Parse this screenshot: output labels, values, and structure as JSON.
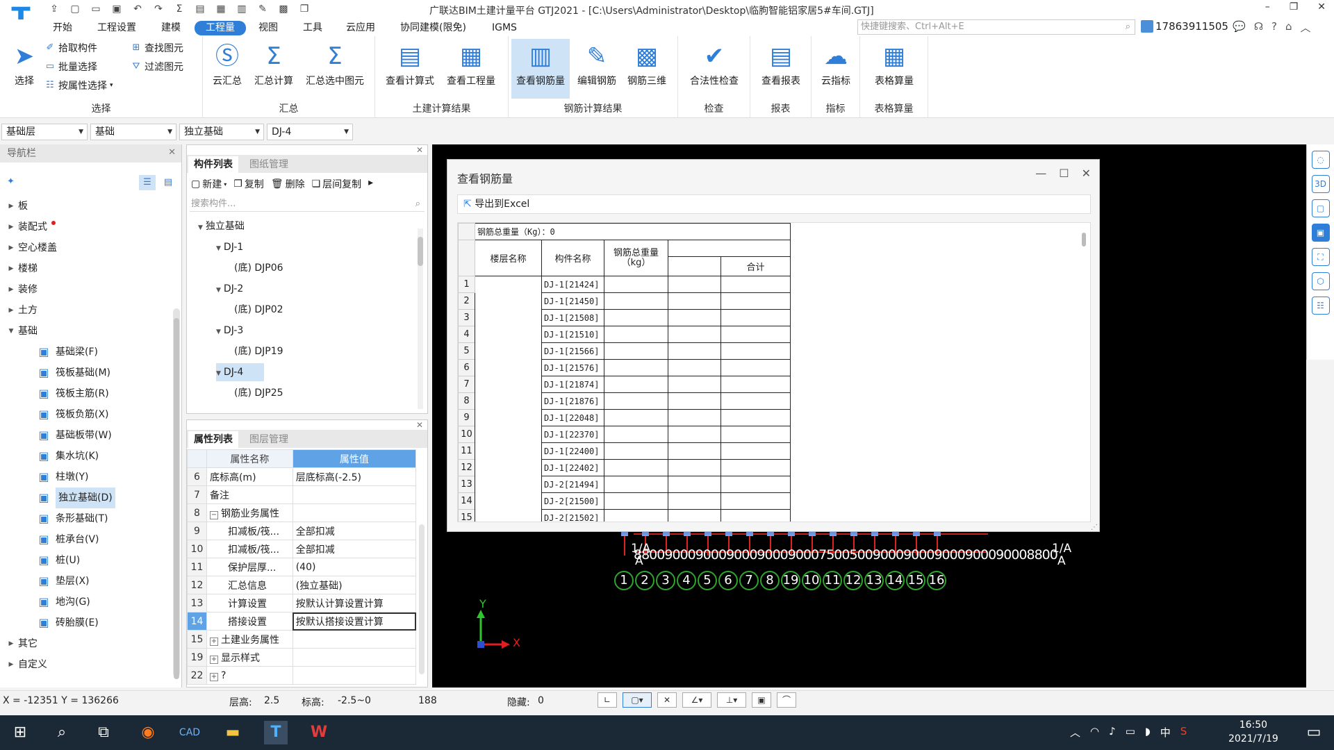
{
  "window": {
    "title": "广联达BIM土建计量平台 GTJ2021 - [C:\\Users\\Administrator\\Desktop\\临朐智能铝家居5#车间.GTJ]",
    "logo": "T"
  },
  "menu": {
    "items": [
      "开始",
      "工程设置",
      "建模",
      "工程量",
      "视图",
      "工具",
      "云应用",
      "协同建模(限免)",
      "IGMS"
    ],
    "active": "工程量",
    "search_placeholder": "快捷键搜索、Ctrl+Alt+E",
    "user_phone": "17863911505"
  },
  "ribbon": {
    "select_group": {
      "label": "选择",
      "select": "选择",
      "pick_component": "拾取构件",
      "batch_select": "批量选择",
      "by_attr_select": "按属性选择",
      "find_element": "查找图元",
      "filter_element": "过滤图元"
    },
    "summary_group": {
      "label": "汇总",
      "cloud_summary": "云汇总",
      "summary_calc": "汇总计算",
      "summary_selected": "汇总选中图元"
    },
    "civil_group": {
      "label": "土建计算结果",
      "view_formula": "查看计算式",
      "view_quantity": "查看工程量"
    },
    "rebar_group": {
      "label": "钢筋计算结果",
      "view_rebar": "查看钢筋量",
      "edit_rebar": "编辑钢筋",
      "rebar_3d": "钢筋三维"
    },
    "check_group": {
      "label": "检查",
      "legality_check": "合法性检查"
    },
    "report_group": {
      "label": "报表",
      "view_report": "查看报表"
    },
    "index_group": {
      "label": "指标",
      "cloud_index": "云指标"
    },
    "table_group": {
      "label": "表格算量",
      "table_calc": "表格算量"
    }
  },
  "filters": {
    "floor": "基础层",
    "category": "基础",
    "type": "独立基础",
    "component": "DJ-4"
  },
  "nav": {
    "title": "导航栏",
    "items": [
      {
        "label": "板",
        "open": false
      },
      {
        "label": "装配式",
        "open": false
      },
      {
        "label": "空心楼盖",
        "open": false
      },
      {
        "label": "楼梯",
        "open": false
      },
      {
        "label": "装修",
        "open": false
      },
      {
        "label": "土方",
        "open": false
      },
      {
        "label": "基础",
        "open": true
      }
    ],
    "children": [
      {
        "label": "基础梁(F)",
        "icon": "beam-icon"
      },
      {
        "label": "筏板基础(M)",
        "icon": "raft-icon"
      },
      {
        "label": "筏板主筋(R)",
        "icon": "raft-main-rebar-icon"
      },
      {
        "label": "筏板负筋(X)",
        "icon": "raft-neg-rebar-icon"
      },
      {
        "label": "基础板带(W)",
        "icon": "slab-strip-icon"
      },
      {
        "label": "集水坑(K)",
        "icon": "sump-icon"
      },
      {
        "label": "柱墩(Y)",
        "icon": "pier-icon"
      },
      {
        "label": "独立基础(D)",
        "icon": "isolated-footing-icon"
      },
      {
        "label": "条形基础(T)",
        "icon": "strip-footing-icon"
      },
      {
        "label": "桩承台(V)",
        "icon": "pile-cap-icon"
      },
      {
        "label": "桩(U)",
        "icon": "pile-icon"
      },
      {
        "label": "垫层(X)",
        "icon": "cushion-icon"
      },
      {
        "label": "地沟(G)",
        "icon": "trench-icon"
      },
      {
        "label": "砖胎膜(E)",
        "icon": "brick-mould-icon"
      }
    ],
    "tail": [
      {
        "label": "其它"
      },
      {
        "label": "自定义"
      }
    ]
  },
  "component_panel": {
    "tabs": [
      "构件列表",
      "图纸管理"
    ],
    "toolbar": {
      "new": "新建",
      "copy": "复制",
      "delete": "删除",
      "floor_copy": "层间复制"
    },
    "search_placeholder": "搜索构件...",
    "tree": [
      {
        "label": "独立基础",
        "level": 0
      },
      {
        "label": "DJ-1",
        "level": 1
      },
      {
        "label": "(底) DJP06",
        "level": 2
      },
      {
        "label": "DJ-2",
        "level": 1
      },
      {
        "label": "(底) DJP02",
        "level": 2
      },
      {
        "label": "DJ-3",
        "level": 1
      },
      {
        "label": "(底) DJP19",
        "level": 2
      },
      {
        "label": "DJ-4",
        "level": 1,
        "selected": true
      },
      {
        "label": "(底) DJP25",
        "level": 2
      }
    ]
  },
  "property_panel": {
    "tabs": [
      "属性列表",
      "图层管理"
    ],
    "headers": {
      "name": "属性名称",
      "value": "属性值"
    },
    "rows": [
      {
        "no": "6",
        "name": "底标高(m)",
        "value": "层底标高(-2.5)"
      },
      {
        "no": "7",
        "name": "备注",
        "value": ""
      },
      {
        "no": "8",
        "name": "钢筋业务属性",
        "value": "",
        "expand": "−"
      },
      {
        "no": "9",
        "name": "扣减板/筏...",
        "value": "全部扣减"
      },
      {
        "no": "10",
        "name": "扣减板/筏...",
        "value": "全部扣减"
      },
      {
        "no": "11",
        "name": "保护层厚...",
        "value": "(40)"
      },
      {
        "no": "12",
        "name": "汇总信息",
        "value": "(独立基础)"
      },
      {
        "no": "13",
        "name": "计算设置",
        "value": "按默认计算设置计算"
      },
      {
        "no": "14",
        "name": "搭接设置",
        "value": "按默认搭接设置计算",
        "selected": true
      },
      {
        "no": "15",
        "name": "土建业务属性",
        "value": "",
        "expand": "+"
      },
      {
        "no": "19",
        "name": "显示样式",
        "value": "",
        "expand": "+"
      },
      {
        "no": "22",
        "name": "?",
        "value": "",
        "expand": "+"
      }
    ]
  },
  "dialog": {
    "title": "查看钢筋量",
    "export_label": "导出到Excel",
    "total_label": "钢筋总重量（Kg）：0",
    "col_floor": "楼层名称",
    "col_component": "构件名称",
    "col_weight": "钢筋总重量\n（kg）",
    "col_total": "合计",
    "rows": [
      {
        "no": "1",
        "name": "DJ-1[21424]"
      },
      {
        "no": "2",
        "name": "DJ-1[21450]"
      },
      {
        "no": "3",
        "name": "DJ-1[21508]"
      },
      {
        "no": "4",
        "name": "DJ-1[21510]"
      },
      {
        "no": "5",
        "name": "DJ-1[21566]"
      },
      {
        "no": "6",
        "name": "DJ-1[21576]"
      },
      {
        "no": "7",
        "name": "DJ-1[21874]"
      },
      {
        "no": "8",
        "name": "DJ-1[21876]"
      },
      {
        "no": "9",
        "name": "DJ-1[22048]"
      },
      {
        "no": "10",
        "name": "DJ-1[22370]"
      },
      {
        "no": "11",
        "name": "DJ-1[22400]"
      },
      {
        "no": "12",
        "name": "DJ-1[22402]"
      },
      {
        "no": "13",
        "name": "DJ-2[21494]"
      },
      {
        "no": "14",
        "name": "DJ-2[21500]"
      },
      {
        "no": "15",
        "name": "DJ-2[21502]"
      }
    ]
  },
  "canvas": {
    "dim_text": "8800900090009000900090007500500900090009000900090008800",
    "grid_labels": [
      "1",
      "2",
      "3",
      "4",
      "5",
      "6",
      "7",
      "8",
      "19",
      "10",
      "11",
      "12",
      "13",
      "14",
      "15",
      "16"
    ],
    "left_label": "1/A",
    "left_sub": "A",
    "right_label": "1/A",
    "right_sub": "A",
    "axis_y": "Y",
    "axis_x": "X",
    "accent": "#dd2222",
    "grid_color": "#2fa52f"
  },
  "status": {
    "coords": "X = -12351 Y = 136266",
    "floor_height_label": "层高:",
    "floor_height": "2.5",
    "elev_label": "标高:",
    "elev": "-2.5~0",
    "count": "188",
    "hidden_label": "隐藏:",
    "hidden": "0"
  },
  "taskbar": {
    "time": "16:50",
    "date": "2021/7/19",
    "ime": "中"
  }
}
